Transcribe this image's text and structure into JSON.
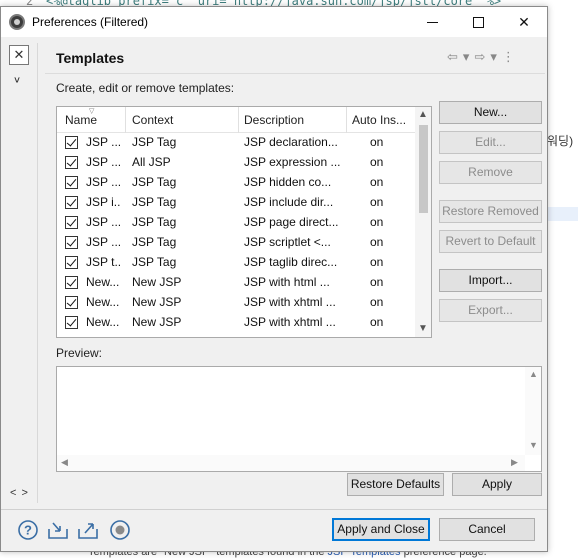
{
  "background": {
    "top_line_number": "2",
    "top_code": "<%@taglib prefix=\"c\" uri=\"http://java.sun.com/jsp/jstl/core\" %>",
    "right_text": "워딩)",
    "bottom_text_pre": "Templates are \"New JSP\" templates found in the ",
    "bottom_text_link": "JSP Templates",
    "bottom_text_post": " preference page."
  },
  "window": {
    "title": "Preferences (Filtered)",
    "minimize_icon": "minimize-icon",
    "maximize_icon": "maximize-icon",
    "close_glyph": "✕"
  },
  "left": {
    "filter_clear_glyph": "✕",
    "tree_chevron": "∨",
    "nav_glyph": "< >"
  },
  "page": {
    "title": "Templates",
    "back_glyph": "⇦",
    "forward_glyph": "⇨",
    "dropdown_glyph": "▾",
    "menu_glyph": "⋮",
    "description": "Create, edit or remove templates:"
  },
  "table": {
    "headers": {
      "name": "Name",
      "context": "Context",
      "description": "Description",
      "auto": "Auto Ins..."
    },
    "rows": [
      {
        "name": "JSP ...",
        "context": "JSP Tag",
        "description": "JSP declaration...",
        "auto": "on"
      },
      {
        "name": "JSP ...",
        "context": "All JSP",
        "description": "JSP expression ...",
        "auto": "on"
      },
      {
        "name": "JSP ...",
        "context": "JSP Tag",
        "description": "JSP hidden co...",
        "auto": "on"
      },
      {
        "name": "JSP i...",
        "context": "JSP Tag",
        "description": "JSP include dir...",
        "auto": "on"
      },
      {
        "name": "JSP ...",
        "context": "JSP Tag",
        "description": "JSP page direct...",
        "auto": "on"
      },
      {
        "name": "JSP ...",
        "context": "JSP Tag",
        "description": "JSP scriptlet <...",
        "auto": "on"
      },
      {
        "name": "JSP t...",
        "context": "JSP Tag",
        "description": "JSP taglib direc...",
        "auto": "on"
      },
      {
        "name": "New...",
        "context": "New JSP",
        "description": "JSP with html ...",
        "auto": "on"
      },
      {
        "name": "New...",
        "context": "New JSP",
        "description": "JSP with xhtml ...",
        "auto": "on"
      },
      {
        "name": "New...",
        "context": "New JSP",
        "description": "JSP with xhtml ...",
        "auto": "on"
      }
    ],
    "scroll_up_glyph": "▲",
    "scroll_down_glyph": "▼"
  },
  "side_buttons": {
    "new": "New...",
    "edit": "Edit...",
    "remove": "Remove",
    "restore_removed": "Restore Removed",
    "revert_to_default": "Revert to Default",
    "import": "Import...",
    "export": "Export..."
  },
  "preview": {
    "label": "Preview:"
  },
  "footer": {
    "restore_defaults": "Restore Defaults",
    "apply": "Apply",
    "apply_and_close": "Apply and Close",
    "cancel": "Cancel",
    "icons": [
      "help-icon",
      "import-icon",
      "export-icon",
      "record-icon"
    ]
  }
}
